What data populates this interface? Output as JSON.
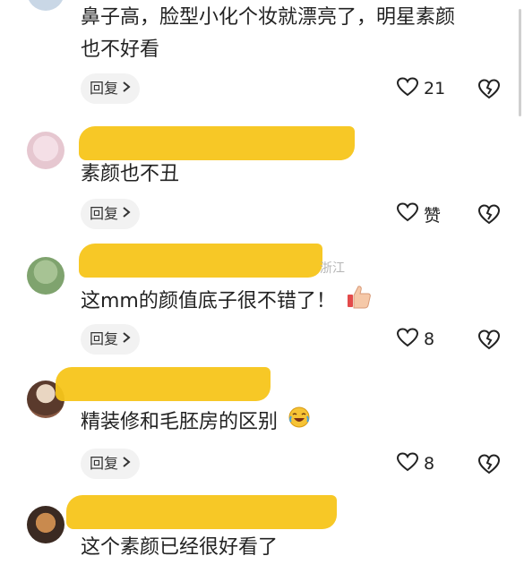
{
  "comments": [
    {
      "text_line1": "鼻子高，脸型小化个妆就漂亮了，明星素颜",
      "text_line2": "也不好看",
      "reply_label": "回复",
      "like_count": "21"
    },
    {
      "text": "素颜也不丑",
      "reply_label": "回复",
      "like_count": "赞"
    },
    {
      "location": "浙江",
      "text": "这mm的颜值底子很不错了！",
      "reply_label": "回复",
      "like_count": "8"
    },
    {
      "text": "精装修和毛胚房的区别",
      "reply_label": "回复",
      "like_count": "8"
    },
    {
      "text": "这个素颜已经很好看了"
    }
  ],
  "colors": {
    "highlight": "#f7c51a",
    "reply_bg": "#f2f2f2"
  }
}
